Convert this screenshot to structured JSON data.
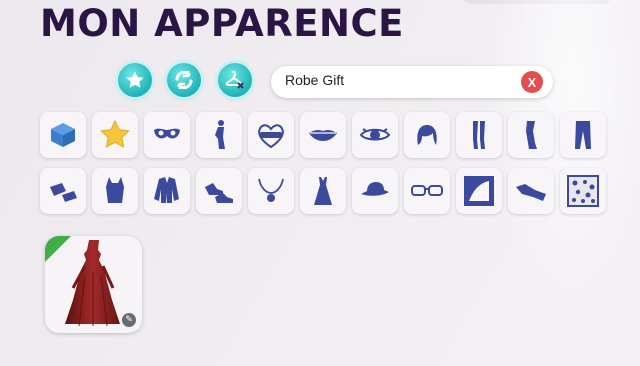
{
  "header": {
    "title": "MON APPARENCE"
  },
  "filters": [
    {
      "name": "favorites-filter",
      "icon": "star-icon"
    },
    {
      "name": "refresh-filter",
      "icon": "refresh-icon"
    },
    {
      "name": "remove-filter",
      "icon": "hanger-remove-icon"
    }
  ],
  "search": {
    "value": "Robe Gift",
    "clear_label": "X"
  },
  "colors": {
    "icon": "#3b4a9c",
    "teal": "#1fb3b8",
    "accent_red": "#e24d4d"
  },
  "categories": {
    "row1": [
      "box-icon",
      "star-icon",
      "eye-mask-icon",
      "body-icon",
      "tattoo-icon",
      "lips-icon",
      "eye-icon",
      "hair-icon",
      "legs-icon",
      "leg-icon",
      "pants-icon"
    ],
    "row2": [
      "gloves-icon",
      "top-icon",
      "jacket-icon",
      "shoes-icon",
      "necklace-icon",
      "dress-icon",
      "hat-icon",
      "glasses-icon",
      "frame-icon",
      "scarf-icon",
      "pattern-icon"
    ]
  },
  "results": [
    {
      "name": "red-gown-item",
      "icon": "gown-icon"
    }
  ]
}
